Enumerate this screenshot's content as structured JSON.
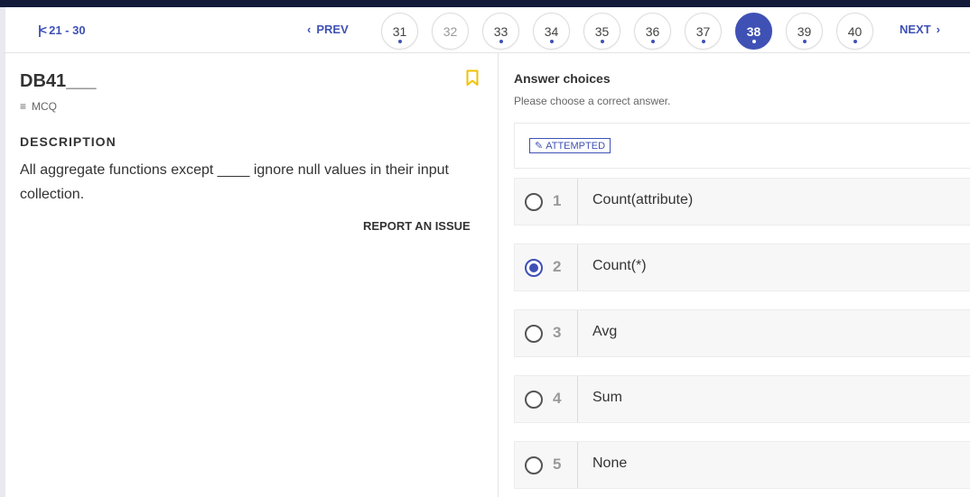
{
  "nav": {
    "range_label": "21 - 30",
    "prev_label": "PREV",
    "next_label": "NEXT",
    "pages": [
      {
        "num": "31",
        "state": "attempted"
      },
      {
        "num": "32",
        "state": "muted"
      },
      {
        "num": "33",
        "state": "attempted"
      },
      {
        "num": "34",
        "state": "attempted"
      },
      {
        "num": "35",
        "state": "attempted"
      },
      {
        "num": "36",
        "state": "attempted"
      },
      {
        "num": "37",
        "state": "attempted"
      },
      {
        "num": "38",
        "state": "active"
      },
      {
        "num": "39",
        "state": "attempted"
      },
      {
        "num": "40",
        "state": "attempted"
      }
    ]
  },
  "question": {
    "title": "DB41___",
    "type": "MCQ",
    "description_heading": "DESCRIPTION",
    "description": "All aggregate functions except ____ ignore null values in their input collection.",
    "report_label": "REPORT AN ISSUE"
  },
  "answers": {
    "heading": "Answer choices",
    "subheading": "Please choose a correct answer.",
    "status_badge": "ATTEMPTED",
    "options": [
      {
        "num": "1",
        "text": "Count(attribute)",
        "selected": false
      },
      {
        "num": "2",
        "text": "Count(*)",
        "selected": true
      },
      {
        "num": "3",
        "text": "Avg",
        "selected": false
      },
      {
        "num": "4",
        "text": "Sum",
        "selected": false
      },
      {
        "num": "5",
        "text": "None",
        "selected": false
      }
    ]
  },
  "colors": {
    "accent": "#3f51b5",
    "bookmark": "#f2c200",
    "topbar": "#141a3a"
  },
  "icons": {
    "first_page": "first-page-icon",
    "prev": "chevron-left-icon",
    "next": "chevron-right-icon",
    "bookmark": "bookmark-icon",
    "type": "list-icon",
    "edit": "pencil-icon"
  }
}
